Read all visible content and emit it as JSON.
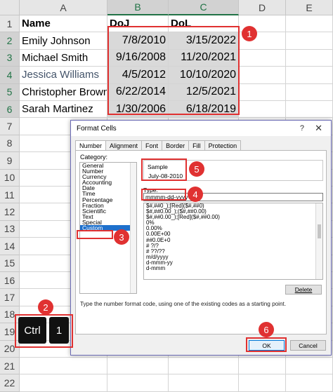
{
  "columns": [
    "A",
    "B",
    "C",
    "D",
    "E"
  ],
  "rows": [
    "1",
    "2",
    "3",
    "4",
    "5",
    "6",
    "7",
    "8",
    "9",
    "10",
    "11",
    "12",
    "13",
    "14",
    "15",
    "16",
    "17",
    "18",
    "19",
    "20",
    "21",
    "22"
  ],
  "headers": {
    "name": "Name",
    "doj": "DoJ",
    "dol": "DoL"
  },
  "records": [
    {
      "name": "Emily Johnson",
      "doj": "7/8/2010",
      "dol": "3/15/2022"
    },
    {
      "name": "Michael Smith",
      "doj": "9/16/2008",
      "dol": "11/20/2021"
    },
    {
      "name": "Jessica Williams",
      "doj": "4/5/2012",
      "dol": "10/10/2020"
    },
    {
      "name": "Christopher Brown",
      "doj": "6/22/2014",
      "dol": "12/5/2021"
    },
    {
      "name": "Sarah Martinez",
      "doj": "1/30/2006",
      "dol": "6/18/2019"
    }
  ],
  "dialog": {
    "title": "Format Cells",
    "help_label": "?",
    "close_label": "✕",
    "tabs": [
      "Number",
      "Alignment",
      "Font",
      "Border",
      "Fill",
      "Protection"
    ],
    "category_label": "Category:",
    "categories": [
      "General",
      "Number",
      "Currency",
      "Accounting",
      "Date",
      "Time",
      "Percentage",
      "Fraction",
      "Scientific",
      "Text",
      "Special",
      "Custom"
    ],
    "selected_category": "Custom",
    "sample_label": "Sample",
    "sample_value": "July-08-2010",
    "type_label": "Type:",
    "type_value": "mmmm-dd-yyyy",
    "format_codes": [
      "$#,##0_);[Red]($#,##0)",
      "$#,##0.00_);($#,##0.00)",
      "$#,##0.00_);[Red]($#,##0.00)",
      "0%",
      "0.00%",
      "0.00E+00",
      "##0.0E+0",
      "# ?/?",
      "# ??/??",
      "m/d/yyyy",
      "d-mmm-yy",
      "d-mmm"
    ],
    "delete_label": "Delete",
    "hint": "Type the number format code, using one of the existing codes as a starting point.",
    "ok_label": "OK",
    "cancel_label": "Cancel"
  },
  "shortcut_keys": [
    "Ctrl",
    "1"
  ],
  "step_badges": [
    "1",
    "2",
    "3",
    "4",
    "5",
    "6"
  ],
  "colors": {
    "annotation": "#e03131",
    "selection": "#d9d9d9",
    "accent": "#217346"
  }
}
